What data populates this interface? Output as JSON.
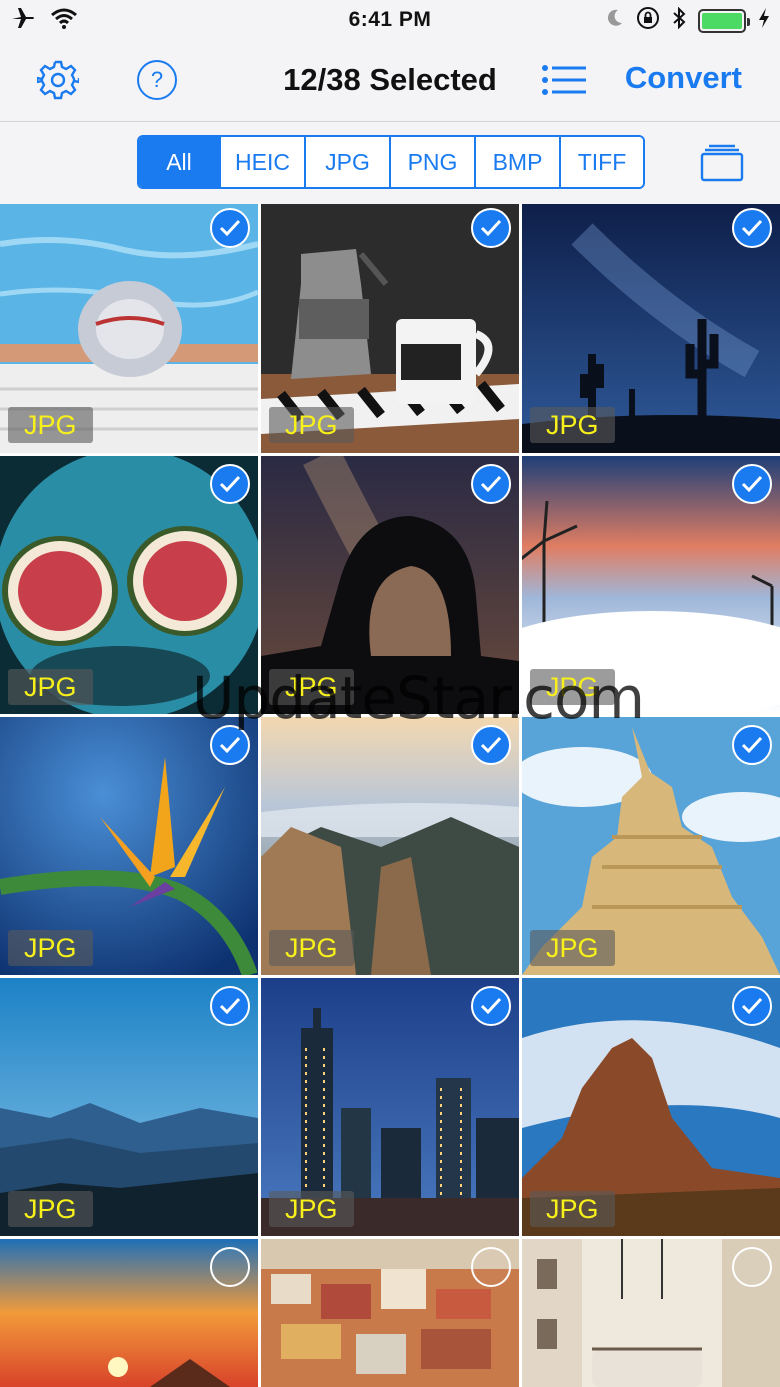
{
  "status_bar": {
    "time": "6:41 PM"
  },
  "nav": {
    "title": "12/38 Selected",
    "convert_label": "Convert"
  },
  "filters": {
    "selected": "All",
    "options": [
      "All",
      "HEIC",
      "JPG",
      "PNG",
      "BMP",
      "TIFF"
    ]
  },
  "grid": {
    "photos": [
      {
        "format": "JPG",
        "selected": true,
        "subject": "pool-hat"
      },
      {
        "format": "JPG",
        "selected": true,
        "subject": "coffee"
      },
      {
        "format": "JPG",
        "selected": true,
        "subject": "night-cactus"
      },
      {
        "format": "JPG",
        "selected": true,
        "subject": "figs"
      },
      {
        "format": "JPG",
        "selected": true,
        "subject": "arch-stars"
      },
      {
        "format": "JPG",
        "selected": true,
        "subject": "wind-turbines"
      },
      {
        "format": "JPG",
        "selected": true,
        "subject": "bird-of-paradise"
      },
      {
        "format": "JPG",
        "selected": true,
        "subject": "mountains-fog"
      },
      {
        "format": "JPG",
        "selected": true,
        "subject": "sand-castle"
      },
      {
        "format": "JPG",
        "selected": true,
        "subject": "blue-mountains"
      },
      {
        "format": "JPG",
        "selected": true,
        "subject": "city-night"
      },
      {
        "format": "JPG",
        "selected": true,
        "subject": "desert-rock"
      },
      {
        "format": "",
        "selected": false,
        "subject": "sunset"
      },
      {
        "format": "",
        "selected": false,
        "subject": "city-roofs"
      },
      {
        "format": "",
        "selected": false,
        "subject": "street-tram"
      }
    ]
  },
  "watermark": "UpdateStar.com",
  "colors": {
    "accent": "#1a7bf0",
    "format_badge_text": "#f7f01a",
    "battery": "#4cd964"
  }
}
